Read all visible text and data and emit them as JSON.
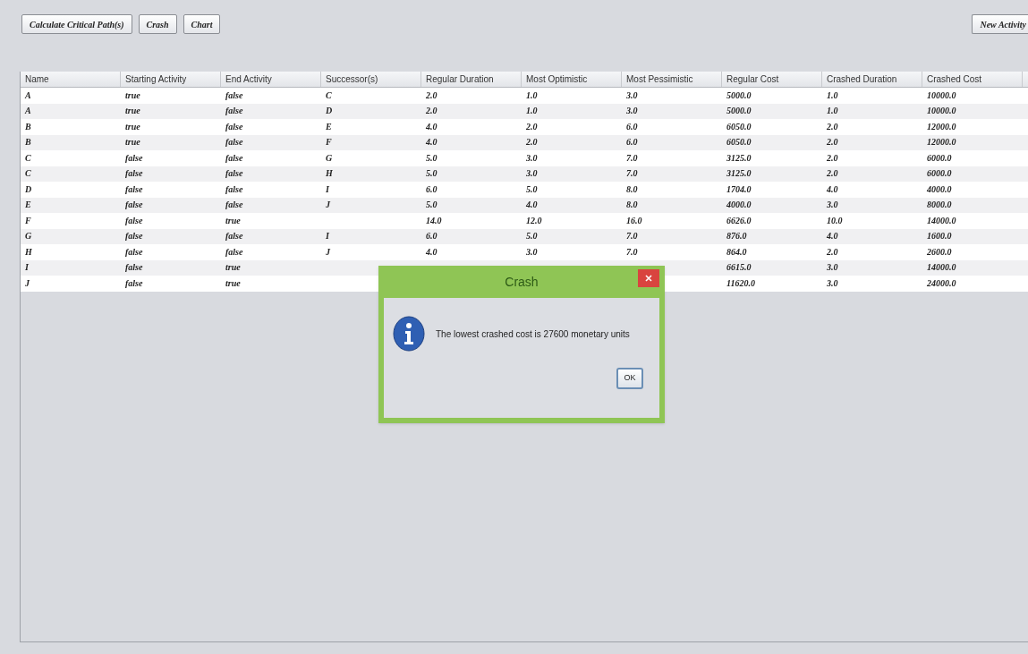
{
  "toolbar": {
    "left_buttons": [
      "Calculate Critical Path(s)",
      "Crash",
      "Chart"
    ],
    "right_button": "New Activity"
  },
  "table": {
    "columns": [
      "Name",
      "Starting Activity",
      "End Activity",
      "Successor(s)",
      "Regular Duration",
      "Most Optimistic",
      "Most Pessimistic",
      "Regular Cost",
      "Crashed Duration",
      "Crashed Cost"
    ],
    "rows": [
      {
        "cells": [
          "A",
          "true",
          "false",
          "C",
          "2.0",
          "1.0",
          "3.0",
          "5000.0",
          "1.0",
          "10000.0"
        ]
      },
      {
        "cells": [
          "A",
          "true",
          "false",
          "D",
          "2.0",
          "1.0",
          "3.0",
          "5000.0",
          "1.0",
          "10000.0"
        ]
      },
      {
        "cells": [
          "B",
          "true",
          "false",
          "E",
          "4.0",
          "2.0",
          "6.0",
          "6050.0",
          "2.0",
          "12000.0"
        ]
      },
      {
        "cells": [
          "B",
          "true",
          "false",
          "F",
          "4.0",
          "2.0",
          "6.0",
          "6050.0",
          "2.0",
          "12000.0"
        ]
      },
      {
        "cells": [
          "C",
          "false",
          "false",
          "G",
          "5.0",
          "3.0",
          "7.0",
          "3125.0",
          "2.0",
          "6000.0"
        ]
      },
      {
        "cells": [
          "C",
          "false",
          "false",
          "H",
          "5.0",
          "3.0",
          "7.0",
          "3125.0",
          "2.0",
          "6000.0"
        ]
      },
      {
        "cells": [
          "D",
          "false",
          "false",
          "I",
          "6.0",
          "5.0",
          "8.0",
          "1704.0",
          "4.0",
          "4000.0"
        ]
      },
      {
        "cells": [
          "E",
          "false",
          "false",
          "J",
          "5.0",
          "4.0",
          "8.0",
          "4000.0",
          "3.0",
          "8000.0"
        ]
      },
      {
        "cells": [
          "F",
          "false",
          "true",
          null,
          "14.0",
          "12.0",
          "16.0",
          "6626.0",
          "10.0",
          "14000.0"
        ]
      },
      {
        "cells": [
          "G",
          "false",
          "false",
          "I",
          "6.0",
          "5.0",
          "7.0",
          "876.0",
          "4.0",
          "1600.0"
        ]
      },
      {
        "cells": [
          "H",
          "false",
          "false",
          "J",
          "4.0",
          "3.0",
          "7.0",
          "864.0",
          "2.0",
          "2600.0"
        ]
      },
      {
        "cells": [
          "I",
          "false",
          "true",
          null,
          null,
          null,
          null,
          "6615.0",
          "3.0",
          "14000.0"
        ]
      },
      {
        "cells": [
          "J",
          "false",
          "true",
          null,
          null,
          null,
          null,
          "11620.0",
          "3.0",
          "24000.0"
        ]
      }
    ]
  },
  "dialog": {
    "title": "Crash",
    "message": "The lowest crashed cost is 27600 monetary units",
    "button": "OK"
  }
}
